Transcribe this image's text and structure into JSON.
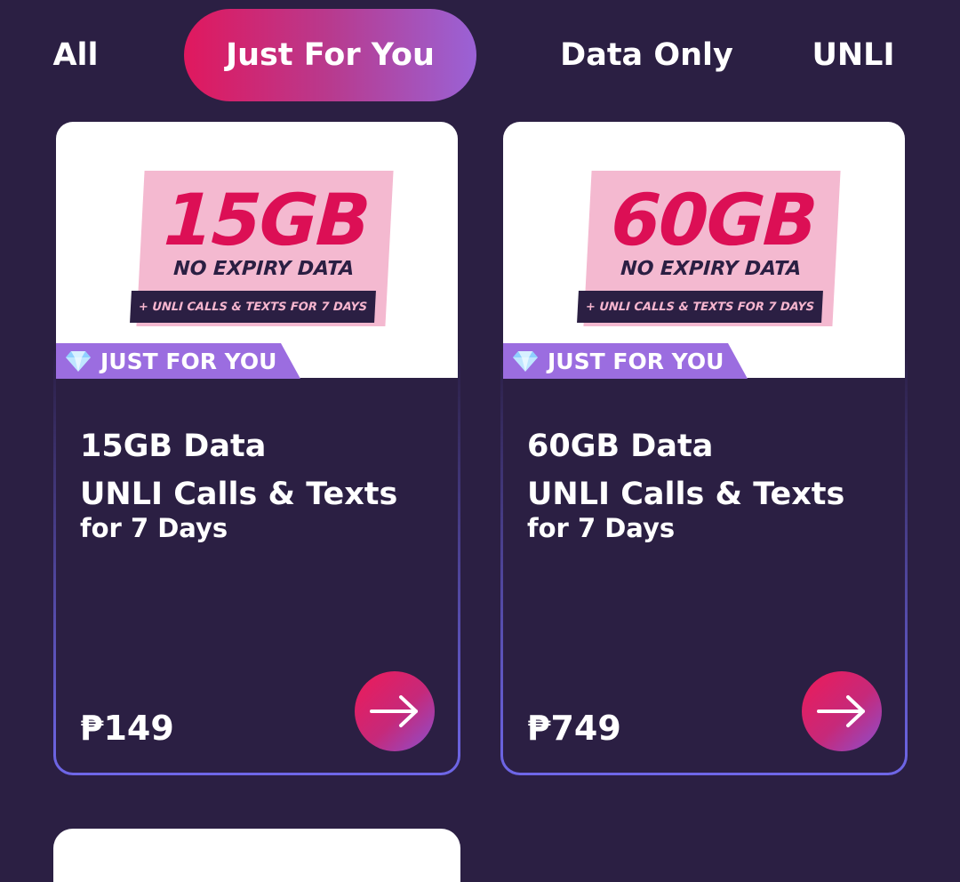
{
  "tabs": [
    {
      "label": "All",
      "active": false
    },
    {
      "label": "Just For You",
      "active": true
    },
    {
      "label": "Data Only",
      "active": false
    },
    {
      "label": "UNLI",
      "active": false
    }
  ],
  "cards": [
    {
      "promo_amount": "15GB",
      "promo_sub": "NO EXPIRY DATA",
      "promo_band": "+ UNLI CALLS & TEXTS FOR 7 DAYS",
      "badge": "JUST FOR YOU",
      "title_line1": "15GB Data",
      "title_line2": "UNLI Calls & Texts",
      "subtitle": "for 7 Days",
      "price": "₱149"
    },
    {
      "promo_amount": "60GB",
      "promo_sub": "NO EXPIRY DATA",
      "promo_band": "+ UNLI CALLS & TEXTS FOR 7 DAYS",
      "badge": "JUST FOR YOU",
      "title_line1": "60GB Data",
      "title_line2": "UNLI Calls & Texts",
      "subtitle": "for 7 Days",
      "price": "₱749"
    }
  ],
  "icons": {
    "badge": "diamond-icon",
    "action": "arrow-right-icon"
  },
  "colors": {
    "background": "#2b1f43",
    "accent_pink": "#e0185e",
    "accent_purple": "#9a62d6",
    "promo_pink": "#f4b9d0",
    "badge_purple": "#9b6de0"
  }
}
